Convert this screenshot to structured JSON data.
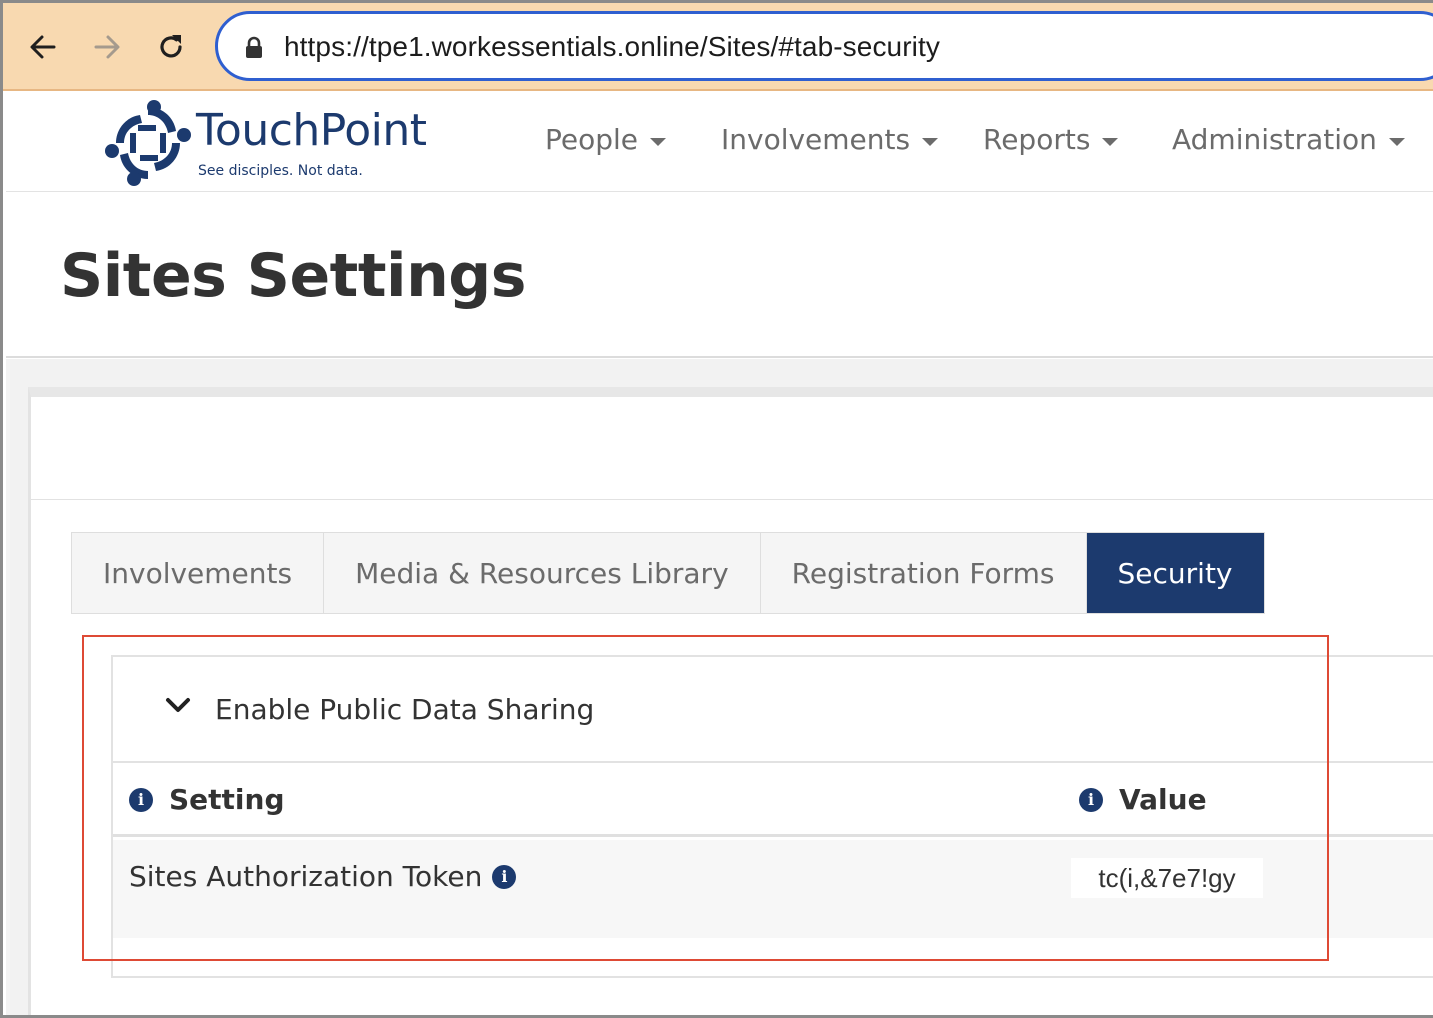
{
  "browser": {
    "url": "https://tpe1.workessentials.online/Sites/#tab-security",
    "back_icon": "arrow-left-icon",
    "forward_icon": "arrow-right-icon",
    "reload_icon": "reload-icon",
    "lock_icon": "lock-icon"
  },
  "header": {
    "brand": "TouchPoint",
    "tagline": "See disciples. Not data.",
    "nav": [
      "People",
      "Involvements",
      "Reports",
      "Administration"
    ]
  },
  "page": {
    "title": "Sites Settings"
  },
  "tabs": {
    "items": [
      "Involvements",
      "Media & Resources Library",
      "Registration Forms",
      "Security"
    ],
    "active": "Security"
  },
  "section": {
    "title": "Enable Public Data Sharing",
    "columns": {
      "setting": "Setting",
      "value": "Value"
    },
    "rows": [
      {
        "setting": "Sites Authorization Token",
        "value": "tc(i,&7e7!gy"
      }
    ]
  },
  "colors": {
    "brand": "#1c3a6e",
    "browser_bar": "#f8d9b0",
    "url_focus": "#2f5fd0",
    "highlight": "#de4a35"
  }
}
